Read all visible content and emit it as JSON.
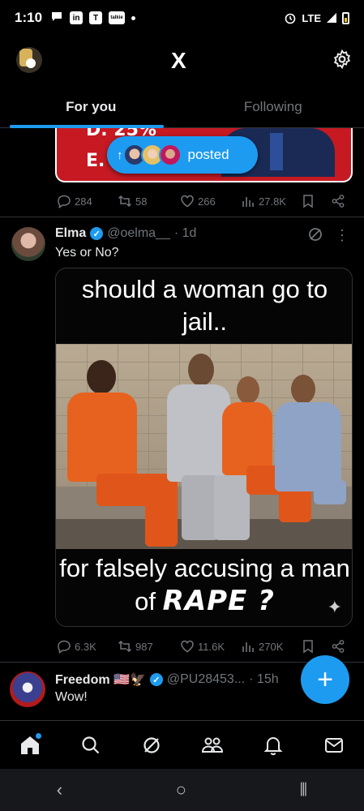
{
  "status_bar": {
    "time": "1:10",
    "icons": [
      "message-icon",
      "linkedin-icon",
      "tmobile-icon",
      "talkie-icon"
    ],
    "network": "LTE"
  },
  "header": {
    "logo": "X",
    "tabs": [
      {
        "label": "For you",
        "active": true
      },
      {
        "label": "Following",
        "active": false
      }
    ]
  },
  "previous_tweet": {
    "card_lines": [
      "D. 25%",
      "E."
    ],
    "metrics": {
      "replies": "284",
      "reposts": "58",
      "likes": "266",
      "views": "27.8K"
    }
  },
  "posted_pill": {
    "label": "posted"
  },
  "tweet": {
    "name": "Elma",
    "handle": "@oelma__",
    "time": "· 1d",
    "text": "Yes or No?",
    "image_top_text": "should a woman go to jail..",
    "image_bottom_text": "for falsely accusing a man of",
    "image_bottom_emph": "RAPE ?",
    "metrics": {
      "replies": "6.3K",
      "reposts": "987",
      "likes": "11.6K",
      "views": "270K"
    }
  },
  "next_tweet": {
    "name": "Freedom 🇺🇸🦅",
    "handle": "@PU28453...",
    "time": "· 15h",
    "text": "Wow!"
  },
  "fab": {
    "label": "+"
  },
  "bottom_nav": [
    "home-icon",
    "search-icon",
    "grok-icon",
    "communities-icon",
    "notifications-icon",
    "messages-icon"
  ],
  "colors": {
    "accent": "#1d9bf0",
    "background": "#000000",
    "muted": "#71767b",
    "card_red": "#c61922"
  }
}
